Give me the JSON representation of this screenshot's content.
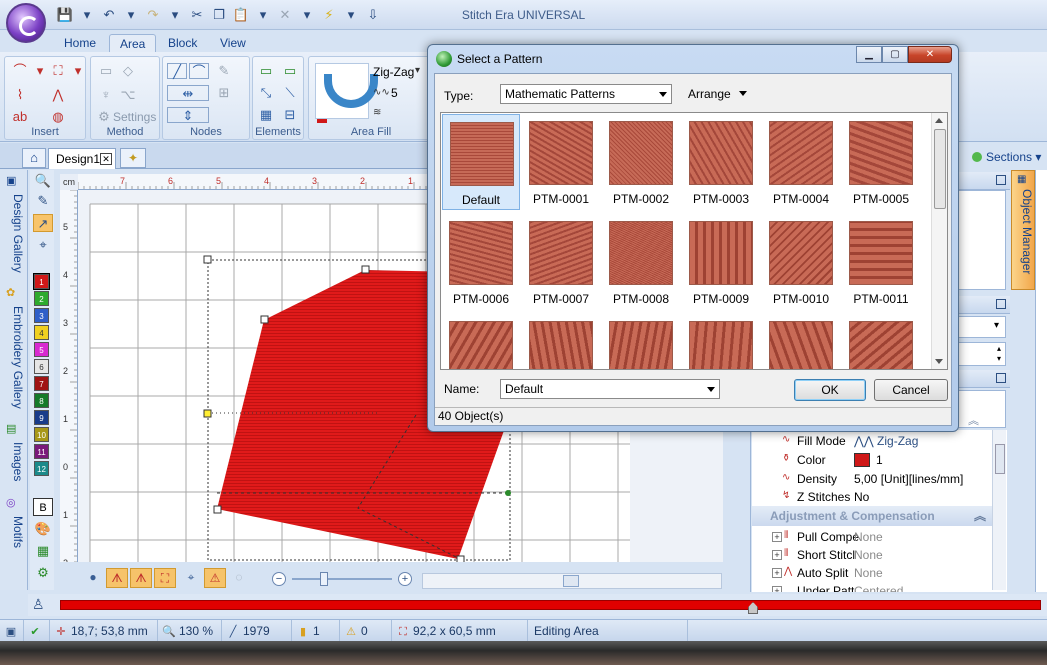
{
  "app": {
    "title": "Stitch Era UNIVERSAL"
  },
  "ribbon": {
    "tabs": [
      {
        "label": "Home"
      },
      {
        "label": "Area"
      },
      {
        "label": "Block"
      },
      {
        "label": "View"
      }
    ],
    "active_tab": "Area",
    "groups": {
      "insert": "Insert",
      "method": "Method",
      "method_settings": "Settings",
      "nodes": "Nodes",
      "elements": "Elements",
      "area_fill": "Area Fill",
      "fill_type": "Zig-Zag",
      "fill_density": "5"
    }
  },
  "document": {
    "tab_label": "Design1",
    "ruler_unit": "cm",
    "hruler_ticks": [
      "7",
      "6",
      "5",
      "4",
      "3",
      "2",
      "1"
    ],
    "vruler_ticks": [
      "5",
      "4",
      "3",
      "2",
      "1",
      "0",
      "1",
      "2"
    ]
  },
  "left_gallery": {
    "tabs": [
      "Design Gallery",
      "Embroidery Gallery",
      "Images",
      "Motifs"
    ]
  },
  "palette": {
    "colors": [
      {
        "label": "1",
        "hex": "#d01818"
      },
      {
        "label": "2",
        "hex": "#2eaa2e"
      },
      {
        "label": "3",
        "hex": "#2f5fc8"
      },
      {
        "label": "4",
        "hex": "#f0d020"
      },
      {
        "label": "5",
        "hex": "#d82ad0"
      },
      {
        "label": "6",
        "hex": "#e6e6e6"
      },
      {
        "label": "7",
        "hex": "#a01414"
      },
      {
        "label": "8",
        "hex": "#167a2a"
      },
      {
        "label": "9",
        "hex": "#1a3c8a"
      },
      {
        "label": "10",
        "hex": "#a89818"
      },
      {
        "label": "11",
        "hex": "#7a1a7a"
      },
      {
        "label": "12",
        "hex": "#1c8a8a"
      }
    ],
    "b_label": "B"
  },
  "right_panel": {
    "sections_label": "Sections",
    "object_manager_label": "Object Manager",
    "properties": [
      {
        "name": "Fill Mode",
        "value": "Zig-Zag",
        "icon": "fill-mode-icon"
      },
      {
        "name": "Color",
        "value": "1",
        "icon": "color-icon",
        "swatch": "#d01818"
      },
      {
        "name": "Density",
        "value": "5,00 [Unit][lines/mm]",
        "icon": "density-icon"
      },
      {
        "name": "Z Stitches",
        "value": "No",
        "icon": "z-stitches-icon"
      }
    ],
    "adjust_section": "Adjustment & Compensation",
    "adjust_rows": [
      {
        "name": "Pull Compe",
        "value": "None"
      },
      {
        "name": "Short Stitcl",
        "value": "None"
      },
      {
        "name": "Auto Split",
        "value": "None"
      },
      {
        "name": "Under Patt",
        "value": "Centered"
      }
    ]
  },
  "dialog": {
    "title": "Select a Pattern",
    "type_label": "Type:",
    "type_value": "Mathematic Patterns",
    "arrange_label": "Arrange",
    "patterns": [
      "Default",
      "PTM-0001",
      "PTM-0002",
      "PTM-0003",
      "PTM-0004",
      "PTM-0005",
      "PTM-0006",
      "PTM-0007",
      "PTM-0008",
      "PTM-0009",
      "PTM-0010",
      "PTM-0011",
      "",
      "",
      "",
      "",
      "",
      ""
    ],
    "selected_pattern": "Default",
    "name_label": "Name:",
    "name_value": "Default",
    "ok_label": "OK",
    "cancel_label": "Cancel",
    "status": "40 Object(s)"
  },
  "status_bar": {
    "coords": "18,7; 53,8 mm",
    "zoom": "130 %",
    "stitches": "1979",
    "objects": "1",
    "warnings": "0",
    "size": "92,2 x 60,5 mm",
    "mode": "Editing Area"
  }
}
